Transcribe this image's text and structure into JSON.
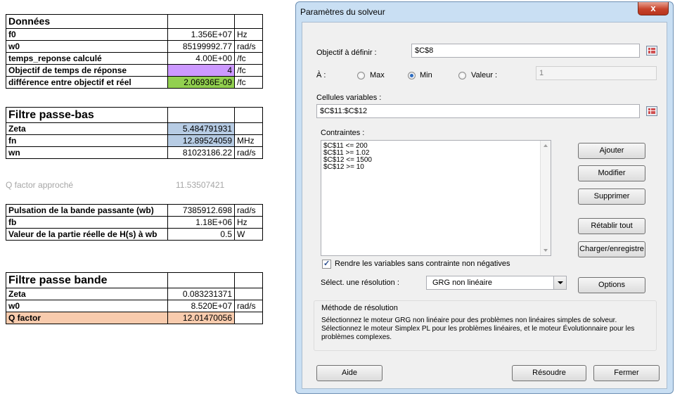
{
  "sheet": {
    "donnees": {
      "header": "Données",
      "rows": [
        {
          "label": "f0",
          "value": "1.356E+07",
          "unit": "Hz"
        },
        {
          "label": "w0",
          "value": "85199992.77",
          "unit": "rad/s"
        },
        {
          "label": "temps_reponse calculé",
          "value": "4.00E+00",
          "unit": "/fc"
        },
        {
          "label": "Objectif de temps de réponse",
          "value": "4",
          "unit": "/fc"
        },
        {
          "label": "différence entre objectif et réel",
          "value": "2.06936E-09",
          "unit": "/fc"
        }
      ]
    },
    "passe_bas": {
      "header": "Filtre passe-bas",
      "rows": [
        {
          "label": "Zeta",
          "value": "5.484791931",
          "unit": ""
        },
        {
          "label": "fn",
          "value": "12.89524059",
          "unit": "MHz"
        },
        {
          "label": "wn",
          "value": "81023186.22",
          "unit": "rad/s"
        }
      ]
    },
    "q_approx": {
      "label": "Q factor approché",
      "value": "11.53507421"
    },
    "bande_passante": {
      "rows": [
        {
          "label": "Pulsation de la bande passante (wb)",
          "value": "7385912.698",
          "unit": "rad/s"
        },
        {
          "label": "fb",
          "value": "1.18E+06",
          "unit": "Hz"
        },
        {
          "label": "Valeur de la partie réelle de H(s) à wb",
          "value": "0.5",
          "unit": "W"
        }
      ]
    },
    "passe_bande": {
      "header": "Filtre passe bande",
      "rows": [
        {
          "label": "Zeta",
          "value": "0.083231371",
          "unit": ""
        },
        {
          "label": "w0",
          "value": "8.520E+07",
          "unit": "rad/s"
        },
        {
          "label": "Q factor",
          "value": "12.01470056",
          "unit": ""
        }
      ]
    },
    "colors": {
      "purple": "#cc99ff",
      "green": "#92d050",
      "blue": "#b7cce4",
      "orange": "#f8cbad"
    }
  },
  "dialog": {
    "title": "Paramètres du solveur",
    "close": "x",
    "objectif_label": "Objectif à définir :",
    "objectif_value": "$C$8",
    "a_label": "À :",
    "radio_max": "Max",
    "radio_min": "Min",
    "radio_valeur": "Valeur :",
    "valeur_value": "1",
    "cellules_label": "Cellules variables :",
    "cellules_value": "$C$11:$C$12",
    "contraintes_label": "Contraintes :",
    "contraintes": [
      "$C$11 <= 200",
      "$C$11 >= 1.02",
      "$C$12 <= 1500",
      "$C$12 >= 10"
    ],
    "btn_ajouter": "Ajouter",
    "btn_modifier": "Modifier",
    "btn_supprimer": "Supprimer",
    "btn_retablir": "Rétablir tout",
    "btn_charger": "Charger/enregistre",
    "checkbox_label": "Rendre les variables sans contrainte non négatives",
    "select_label": "Sélect. une résolution :",
    "select_value": "GRG non linéaire",
    "btn_options": "Options",
    "methode_title": "Méthode de résolution",
    "methode_text": "Sélectionnez le moteur GRG non linéaire pour des problèmes non linéaires simples de solveur. Sélectionnez le moteur Simplex PL pour les problèmes linéaires, et le moteur Évolutionnaire pour les problèmes complexes.",
    "btn_aide": "Aide",
    "btn_resoudre": "Résoudre",
    "btn_fermer": "Fermer"
  }
}
